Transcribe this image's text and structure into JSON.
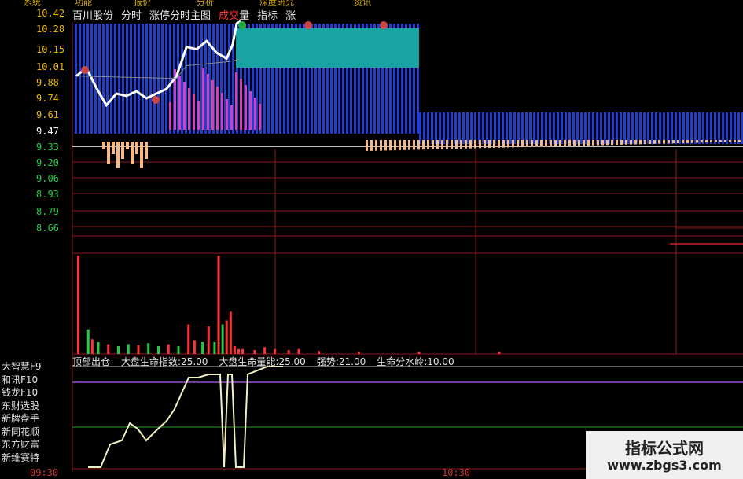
{
  "top_menu": [
    "系统",
    "功能",
    "报价",
    "分析",
    "深度研究",
    "资讯"
  ],
  "title": {
    "stock_name": "百川股份",
    "mode": "分时",
    "main_chart": "涨停分时主图",
    "volume_label": "成交",
    "volume_suffix": "量",
    "indicator": "指标",
    "extra": "涨"
  },
  "price_axis": {
    "upper": [
      "10.42",
      "10.28",
      "10.15",
      "10.01",
      "9.88",
      "9.74",
      "9.61"
    ],
    "prev_close": "9.47",
    "lower": [
      "9.33",
      "9.20",
      "9.06",
      "8.93",
      "8.79",
      "8.66"
    ]
  },
  "indicator_bar": {
    "name": "顶部出仓",
    "items": [
      "大盘生命指数:25.00",
      "大盘生命量能:25.00",
      "强势:21.00",
      "生命分水岭:10.00"
    ]
  },
  "side_menu": [
    "大智慧F9",
    "和讯F10",
    "钱龙F10",
    "东财选股",
    "新牌盘手",
    "新同花顺",
    "东方财富",
    "新维赛特"
  ],
  "time_axis": [
    "09:30",
    "10:30"
  ],
  "watermark": {
    "title": "指标公式网",
    "url": "www.zbgs3.com"
  },
  "colors": {
    "up": "#ff3333",
    "down": "#22cc44",
    "price_line": "#ffffff",
    "grid": "#8b1a1a",
    "cyan_band": "#1aa3a3"
  },
  "chart_data": {
    "type": "line",
    "price_line": [
      {
        "t": 0,
        "p": 9.95
      },
      {
        "t": 5,
        "p": 10.02
      },
      {
        "t": 10,
        "p": 9.85
      },
      {
        "t": 15,
        "p": 9.7
      },
      {
        "t": 20,
        "p": 9.8
      },
      {
        "t": 25,
        "p": 9.78
      },
      {
        "t": 30,
        "p": 9.82
      },
      {
        "t": 35,
        "p": 9.76
      },
      {
        "t": 40,
        "p": 9.8
      },
      {
        "t": 45,
        "p": 9.84
      },
      {
        "t": 50,
        "p": 9.95
      },
      {
        "t": 55,
        "p": 10.2
      },
      {
        "t": 60,
        "p": 10.18
      },
      {
        "t": 65,
        "p": 10.25
      },
      {
        "t": 70,
        "p": 10.15
      },
      {
        "t": 75,
        "p": 10.1
      },
      {
        "t": 78,
        "p": 10.22
      },
      {
        "t": 80,
        "p": 10.4
      },
      {
        "t": 82,
        "p": 10.42
      }
    ],
    "volume": [
      {
        "t": 0,
        "v": 100,
        "c": "up"
      },
      {
        "t": 5,
        "v": 25,
        "c": "down"
      },
      {
        "t": 7,
        "v": 15,
        "c": "up"
      },
      {
        "t": 10,
        "v": 12,
        "c": "down"
      },
      {
        "t": 15,
        "v": 10,
        "c": "up"
      },
      {
        "t": 20,
        "v": 8,
        "c": "down"
      },
      {
        "t": 25,
        "v": 10,
        "c": "down"
      },
      {
        "t": 30,
        "v": 9,
        "c": "up"
      },
      {
        "t": 35,
        "v": 11,
        "c": "down"
      },
      {
        "t": 40,
        "v": 8,
        "c": "down"
      },
      {
        "t": 45,
        "v": 10,
        "c": "up"
      },
      {
        "t": 50,
        "v": 8,
        "c": "down"
      },
      {
        "t": 55,
        "v": 30,
        "c": "up"
      },
      {
        "t": 58,
        "v": 14,
        "c": "up"
      },
      {
        "t": 62,
        "v": 12,
        "c": "down"
      },
      {
        "t": 65,
        "v": 28,
        "c": "up"
      },
      {
        "t": 68,
        "v": 12,
        "c": "down"
      },
      {
        "t": 70,
        "v": 100,
        "c": "up"
      },
      {
        "t": 72,
        "v": 30,
        "c": "down"
      },
      {
        "t": 74,
        "v": 34,
        "c": "up"
      },
      {
        "t": 76,
        "v": 43,
        "c": "up"
      },
      {
        "t": 78,
        "v": 8,
        "c": "up"
      },
      {
        "t": 80,
        "v": 5,
        "c": "up"
      },
      {
        "t": 82,
        "v": 5,
        "c": "up"
      },
      {
        "t": 88,
        "v": 4,
        "c": "up"
      },
      {
        "t": 93,
        "v": 7,
        "c": "up"
      },
      {
        "t": 98,
        "v": 5,
        "c": "up"
      },
      {
        "t": 105,
        "v": 4,
        "c": "up"
      },
      {
        "t": 110,
        "v": 5,
        "c": "up"
      },
      {
        "t": 120,
        "v": 3,
        "c": "up"
      },
      {
        "t": 140,
        "v": 2,
        "c": "up"
      },
      {
        "t": 170,
        "v": 2,
        "c": "up"
      },
      {
        "t": 210,
        "v": 2,
        "c": "up"
      }
    ]
  }
}
